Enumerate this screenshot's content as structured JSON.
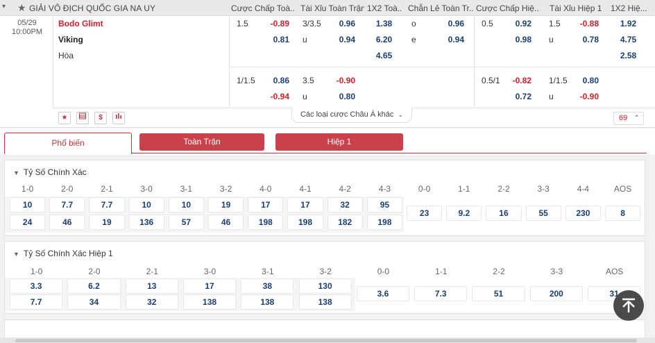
{
  "header": {
    "league": "GIẢI VÔ ĐỊCH QUỐC GIA NA UY",
    "columns": [
      "Cược Chấp Toà...",
      "Tài Xỉu Toàn Trận",
      "1X2 Toà...",
      "Chẵn Lẻ Toàn Tr...",
      "Cược Chấp Hiệ...",
      "Tài Xỉu Hiệp 1",
      "1X2 Hiệ..."
    ]
  },
  "match": {
    "date": "05/29",
    "time": "10:00PM",
    "home": "Bodo Glimt",
    "away": "Viking",
    "draw": "Hòa",
    "row1": {
      "hdp_line": "1.5",
      "hdp_home": "-0.89",
      "hdp_away": "0.81",
      "ou_line": "3/3.5",
      "ou_over": "0.96",
      "ou_under_lbl": "u",
      "ou_under": "0.94",
      "x12_home": "1.38",
      "x12_away": "6.20",
      "x12_draw": "4.65",
      "oe_o_lbl": "o",
      "oe_o": "0.96",
      "oe_e_lbl": "e",
      "oe_e": "0.94",
      "h1_hdp_line": "0.5",
      "h1_hdp_home": "0.92",
      "h1_hdp_away": "0.98",
      "h1_ou_line": "1.5",
      "h1_ou_over": "-0.88",
      "h1_ou_under_lbl": "u",
      "h1_ou_under": "0.78",
      "h1_x12_home": "1.92",
      "h1_x12_away": "4.75",
      "h1_x12_draw": "2.58"
    },
    "row2": {
      "hdp_line": "1/1.5",
      "hdp_home": "0.86",
      "hdp_away": "-0.94",
      "ou_line": "3.5",
      "ou_over": "-0.90",
      "ou_under_lbl": "u",
      "ou_under": "0.80",
      "h1_hdp_line": "0.5/1",
      "h1_hdp_home": "-0.82",
      "h1_hdp_away": "0.72",
      "h1_ou_line": "1/1.5",
      "h1_ou_over": "0.80",
      "h1_ou_under_lbl": "u",
      "h1_ou_under": "-0.90"
    },
    "more_label": "Các loại cược Châu Á khác",
    "more_count": "69"
  },
  "tabs": {
    "popular": "Phổ biến",
    "full": "Toàn Trận",
    "half": "Hiệp 1"
  },
  "correct_score": {
    "title": "Tỷ Số Chính Xác",
    "headers": [
      "1-0",
      "2-0",
      "2-1",
      "3-0",
      "3-1",
      "3-2",
      "4-0",
      "4-1",
      "4-2",
      "4-3",
      "0-0",
      "1-1",
      "2-2",
      "3-3",
      "4-4",
      "AOS"
    ],
    "home_row": [
      "10",
      "7.7",
      "7.7",
      "10",
      "10",
      "19",
      "17",
      "17",
      "32",
      "95"
    ],
    "away_row": [
      "24",
      "46",
      "19",
      "136",
      "57",
      "46",
      "198",
      "198",
      "182",
      "198"
    ],
    "draw_row": [
      "23",
      "9.2",
      "16",
      "55",
      "230",
      "8"
    ]
  },
  "correct_score_h1": {
    "title": "Tỷ Số Chính Xác Hiệp 1",
    "headers": [
      "1-0",
      "2-0",
      "2-1",
      "3-0",
      "3-1",
      "3-2",
      "0-0",
      "1-1",
      "2-2",
      "3-3",
      "AOS"
    ],
    "home_row": [
      "3.3",
      "6.2",
      "13",
      "17",
      "38",
      "130"
    ],
    "away_row": [
      "7.7",
      "34",
      "32",
      "138",
      "138",
      "138"
    ],
    "draw_row": [
      "3.6",
      "7.3",
      "51",
      "200",
      "31"
    ]
  },
  "colors": {
    "accent": "#c8303a",
    "odds": "#1a3e74",
    "negative": "#d4202a"
  },
  "icons": [
    "star-icon",
    "scoreboard-icon",
    "dollar-icon",
    "stats-icon",
    "chevron-down-icon",
    "chevron-up-icon",
    "back-to-top-icon"
  ]
}
